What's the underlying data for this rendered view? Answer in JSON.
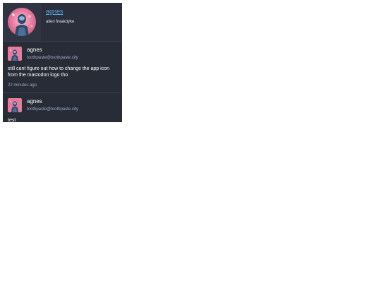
{
  "profile": {
    "display_name": "agnes",
    "bio": "alien freakdyke"
  },
  "posts": [
    {
      "display_name": "agnes",
      "acct": "toothpaste@toothpaste.city",
      "content": "still cant figure out how to change the app icon from the mastodon logo tho",
      "time": "22 minutes ago"
    },
    {
      "display_name": "agnes",
      "acct": "toothpaste@toothpaste.city",
      "content": "test"
    }
  ],
  "colors": {
    "background": "#282c37",
    "link": "#5ba4e5",
    "muted": "#9baec8",
    "text": "#ffffff",
    "avatar_bg": "#e87a9c",
    "avatar_figure": "#2d4a6b"
  }
}
